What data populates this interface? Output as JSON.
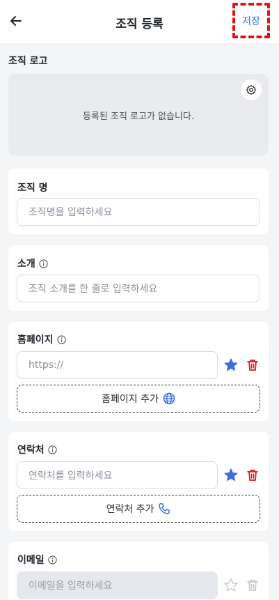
{
  "header": {
    "title": "조직 등록",
    "save_label": "저장"
  },
  "logo_section": {
    "label": "조직 로고",
    "empty_text": "등록된 조직 로고가 없습니다."
  },
  "org_name": {
    "label": "조직 명",
    "placeholder": "조직명을 입력하세요"
  },
  "intro": {
    "label": "소개",
    "placeholder": "조직 소개를 한 줄로 입력하세요"
  },
  "homepage": {
    "label": "홈페이지",
    "placeholder": "https://",
    "add_label": "홈페이지 추가"
  },
  "contact": {
    "label": "연락처",
    "placeholder": "연락처를 입력하세요",
    "add_label": "연락처 추가"
  },
  "email": {
    "label": "이메일",
    "placeholder": "이메일을 입력하세요"
  },
  "colors": {
    "accent": "#3d6ee0",
    "danger": "#e3101a",
    "star": "#3d6ee0"
  },
  "icons": {
    "back": "arrow-left-icon",
    "settings": "gear-icon",
    "info": "info-icon",
    "star": "star-icon",
    "trash": "trash-icon",
    "globe": "globe-icon",
    "phone": "phone-icon"
  }
}
